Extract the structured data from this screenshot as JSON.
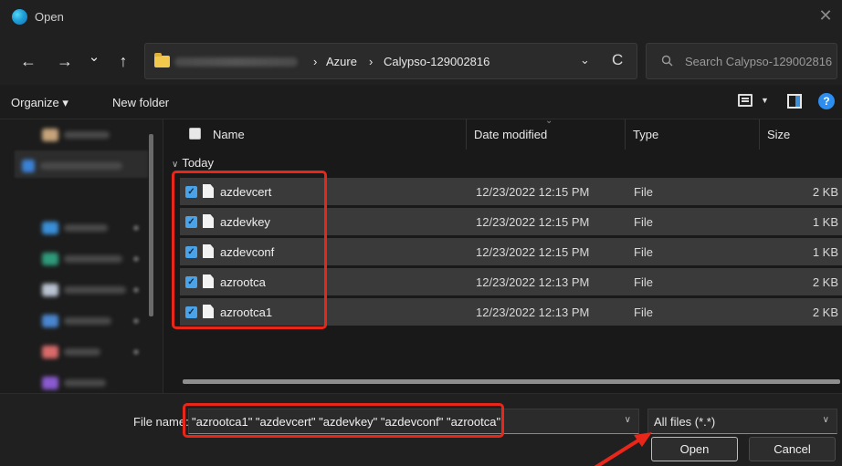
{
  "window": {
    "title": "Open",
    "close_glyph": "✕"
  },
  "nav": {
    "back_glyph": "←",
    "forward_glyph": "→",
    "history_glyph": "⌄",
    "up_glyph": "↑",
    "breadcrumbs": [
      "Azure",
      "Calypso-129002816"
    ],
    "crumb_separator": "›",
    "address_dropdown_glyph": "⌄",
    "refresh_glyph": "C",
    "search_placeholder": "Search Calypso-129002816"
  },
  "commands": {
    "organize_label": "Organize ▾",
    "new_folder_label": "New folder"
  },
  "columns": {
    "name": "Name",
    "date_modified": "Date modified",
    "type": "Type",
    "size": "Size"
  },
  "group": {
    "label": "Today"
  },
  "files": [
    {
      "name": "azdevcert",
      "date": "12/23/2022 12:15 PM",
      "type": "File",
      "size": "2 KB"
    },
    {
      "name": "azdevkey",
      "date": "12/23/2022 12:15 PM",
      "type": "File",
      "size": "1 KB"
    },
    {
      "name": "azdevconf",
      "date": "12/23/2022 12:15 PM",
      "type": "File",
      "size": "1 KB"
    },
    {
      "name": "azrootca",
      "date": "12/23/2022 12:13 PM",
      "type": "File",
      "size": "2 KB"
    },
    {
      "name": "azrootca1",
      "date": "12/23/2022 12:13 PM",
      "type": "File",
      "size": "2 KB"
    }
  ],
  "bottom": {
    "file_name_label": "File name:",
    "file_name_value": "\"azrootca1\" \"azdevcert\" \"azdevkey\" \"azdevconf\" \"azrootca\"",
    "file_type_value": "All files (*.*)",
    "open_label": "Open",
    "cancel_label": "Cancel"
  },
  "colors": {
    "highlight": "#e8261a",
    "accent": "#4aa3e8"
  }
}
